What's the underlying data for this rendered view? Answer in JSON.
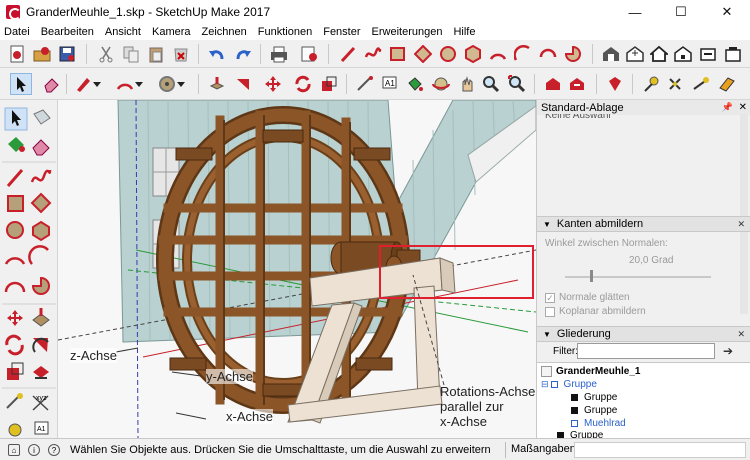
{
  "window": {
    "title": "GranderMeuhle_1.skp - SketchUp Make 2017",
    "controls": {
      "minimize": "—",
      "maximize": "☐",
      "close": "✕"
    }
  },
  "menu": [
    "Datei",
    "Bearbeiten",
    "Ansicht",
    "Kamera",
    "Zeichnen",
    "Funktionen",
    "Fenster",
    "Erweiterungen",
    "Hilfe"
  ],
  "tray": {
    "title": "Standard-Ablage",
    "entity_info_partial": "Keine Auswahl",
    "soften_edges": {
      "title": "Kanten abmildern",
      "angle_label": "Winkel zwischen Normalen:",
      "angle_value": "20,0  Grad",
      "smooth_normals": "Normale glätten",
      "soften_coplanar": "Koplanar abmildern",
      "smooth_normals_checked": true,
      "soften_coplanar_checked": false,
      "slider_fraction": 0.17
    },
    "outliner": {
      "title": "Gliederung",
      "filter_label": "Filter:",
      "filter_value": "",
      "root": "GranderMeuhle_1",
      "items": [
        {
          "label": "Gruppe",
          "level": 1,
          "selected": true,
          "expander": "⊟"
        },
        {
          "label": "Gruppe",
          "level": 2,
          "selected": false,
          "expander": ""
        },
        {
          "label": "Gruppe",
          "level": 2,
          "selected": false,
          "expander": ""
        },
        {
          "label": "Muehlrad",
          "level": 2,
          "selected": true,
          "expander": ""
        },
        {
          "label": "Gruppe",
          "level": 1,
          "selected": false,
          "expander": ""
        }
      ]
    }
  },
  "viewport": {
    "annotations": {
      "z_axis": "z-Achse",
      "y_axis": "y-Achse",
      "x_axis": "x-Achse",
      "rotation_axis": [
        "Rotations-Achse",
        "parallel zur",
        "x-Achse"
      ]
    },
    "colors": {
      "wood": "#8b5528",
      "wood_dark": "#5e3716",
      "stand": "#ece1d2",
      "building": "#b9d1d0",
      "highlight": "#e0202e"
    }
  },
  "status": {
    "message": "Wählen Sie Objekte aus. Drücken Sie die Umschalttaste, um die Auswahl zu erweitern. Zi...",
    "measurements_label": "Maßangaben"
  }
}
